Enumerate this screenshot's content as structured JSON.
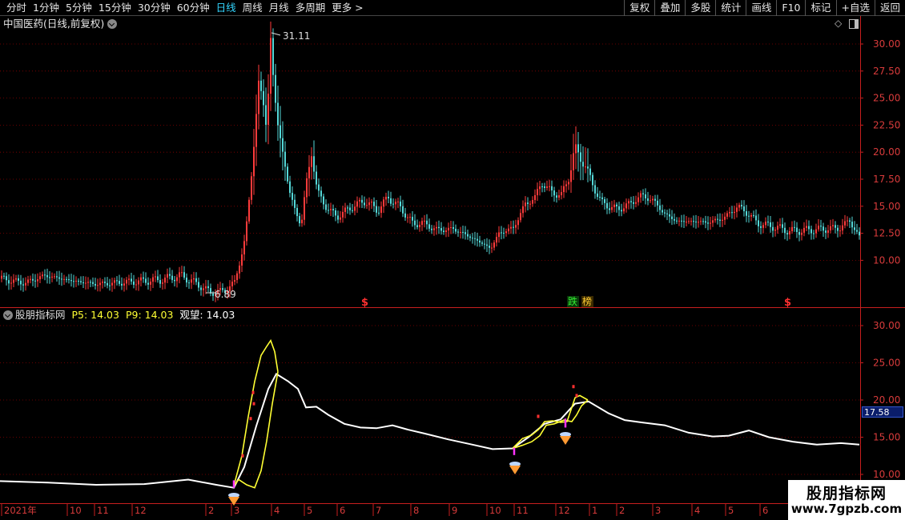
{
  "toolbar": {
    "periods": [
      "分时",
      "1分钟",
      "5分钟",
      "15分钟",
      "30分钟",
      "60分钟",
      "日线",
      "周线",
      "月线",
      "多周期",
      "更多 >"
    ],
    "active_period": "日线",
    "actions": [
      "复权",
      "叠加",
      "多股",
      "统计",
      "画线",
      "F10",
      "标记",
      "+自选",
      "返回"
    ]
  },
  "main_panel": {
    "title": "中国医药(日线,前复权)",
    "y_ticks": [
      "30.00",
      "27.50",
      "25.00",
      "22.50",
      "20.00",
      "17.50",
      "15.00",
      "12.50",
      "10.00"
    ],
    "high_label": "31.11",
    "low_label": "6.89",
    "markers": [
      "$",
      "$",
      "$"
    ],
    "badges": [
      "跌",
      "榜"
    ]
  },
  "indicator_panel": {
    "name": "股朋指标网",
    "p5_label": "P5: 14.03",
    "p9_label": "P9: 14.03",
    "watch_label": "观望: 14.03",
    "y_ticks": [
      "30.00",
      "25.00",
      "20.00",
      "15.00",
      "10.00"
    ],
    "current_value": "17.58"
  },
  "x_axis": {
    "labels": [
      "2021年",
      "10",
      "11",
      "12",
      "2",
      "3",
      "4",
      "5",
      "6",
      "7",
      "8",
      "9",
      "10",
      "11",
      "12",
      "1",
      "2",
      "3",
      "4",
      "5",
      "6"
    ]
  },
  "watermark": {
    "title": "股朋指标网",
    "url": "www.7gpzb.com"
  },
  "colors": {
    "up": "#ff3b3b",
    "down": "#54d8d8",
    "grid": "#8b0000",
    "indicator_fast": "#ffff33",
    "indicator_slow": "#ffffff"
  }
}
